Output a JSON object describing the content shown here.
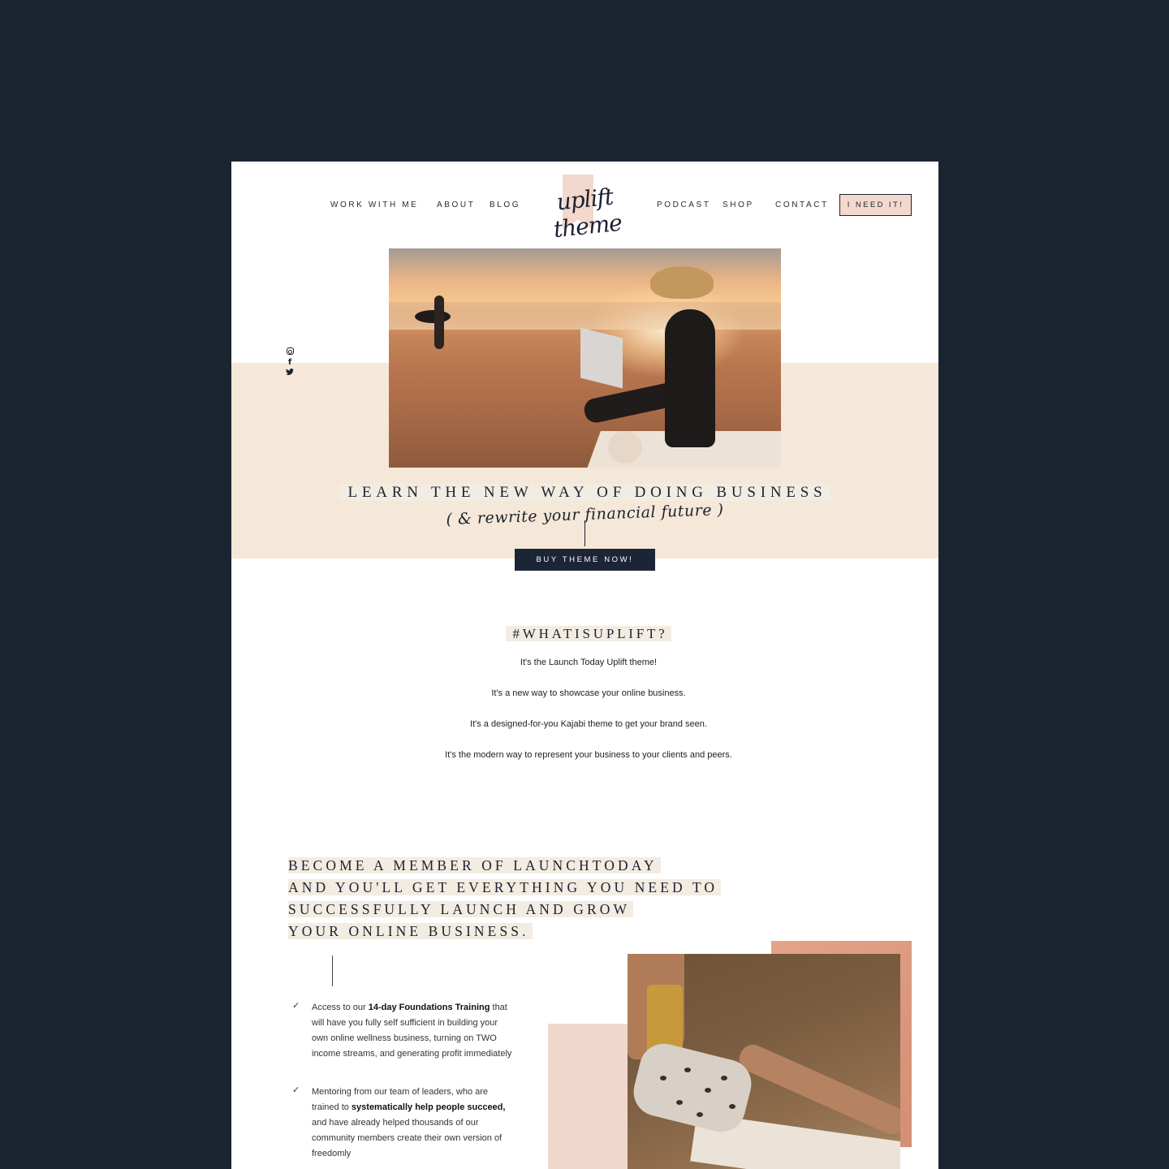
{
  "nav": {
    "left": [
      "WORK WITH ME",
      "ABOUT",
      "BLOG"
    ],
    "right": [
      "PODCAST",
      "SHOP",
      "CONTACT"
    ],
    "logo_text": "uplift theme",
    "cta": "I NEED IT!"
  },
  "social": [
    "instagram-icon",
    "facebook-icon",
    "twitter-icon"
  ],
  "hero": {
    "title": "LEARN THE NEW WAY OF DOING BUSINESS",
    "script": "( & rewrite your financial future )",
    "button": "BUY THEME NOW!"
  },
  "uplift": {
    "heading": "#WHATISUPLIFT?",
    "lines": [
      "It's the Launch Today Uplift theme!",
      "It's a new way to showcase your online business.",
      "It's a designed-for-you Kajabi theme to get your brand seen.",
      "It's the modern way to represent your business to your clients and peers."
    ]
  },
  "member": {
    "heading_lines": [
      "BECOME A MEMBER OF LAUNCHTODAY",
      "AND YOU'LL GET EVERYTHING YOU NEED TO",
      "SUCCESSFULLY LAUNCH AND GROW",
      "YOUR ONLINE BUSINESS."
    ],
    "bullets": [
      {
        "pre": "Access to our ",
        "bold": "14-day Foundations Training",
        "post": " that will have you fully self sufficient in building your own online wellness business, turning on TWO income streams, and generating profit immediately"
      },
      {
        "pre": "Mentoring from our team of leaders, who are trained to ",
        "bold": "systematically help people succeed,",
        "post": " and have already helped thousands of our community members create their own version of freedomly"
      }
    ]
  },
  "colors": {
    "background": "#1b2431",
    "cream": "#f5e8d8",
    "blush": "#f3d8cd",
    "navy": "#1c2536",
    "rose": "#d99a80"
  }
}
